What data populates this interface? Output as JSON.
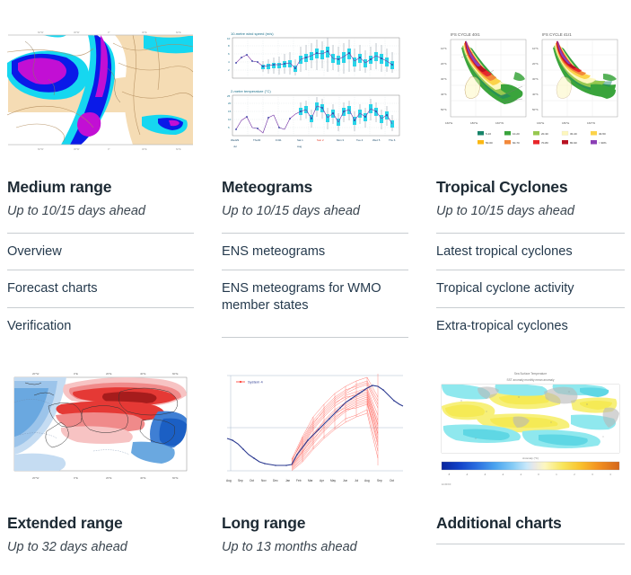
{
  "colors": {
    "heading": "#1d2a34",
    "link": "#253a4d",
    "divider": "#c8cdd1",
    "subtitle": "#3b4650"
  },
  "cards": [
    {
      "id": "medium-range",
      "title": "Medium range",
      "subtitle": "Up to 10/15 days ahead",
      "thumb_name": "medium-range-forecast-map-thumbnail",
      "links": [
        "Overview",
        "Forecast charts",
        "Verification"
      ]
    },
    {
      "id": "meteograms",
      "title": "Meteograms",
      "subtitle": "Up to 10/15 days ahead",
      "thumb_name": "ens-meteogram-thumbnail",
      "links": [
        "ENS meteograms",
        "ENS meteograms for WMO member states"
      ],
      "chart_labels": {
        "panel1": "10-metre wind speed (m/s)",
        "panel2": "2-metre temperature (°C)",
        "x_ticks": [
          "Wed29",
          "Thu30",
          "Fri31",
          "Sat 1",
          "Sun 2",
          "Mon 3",
          "Tue 4",
          "Wed 5",
          "Thu 6",
          "Fri 7",
          "Sat"
        ],
        "x_months": [
          "Jul",
          "Aug"
        ],
        "y1_ticks": [
          "10",
          "8",
          "6",
          "4",
          "2"
        ],
        "y2_ticks": [
          "25",
          "20",
          "15",
          "10",
          "5"
        ]
      }
    },
    {
      "id": "tropical-cyclones",
      "title": "Tropical Cyclones",
      "subtitle": "Up to 10/15 days ahead",
      "thumb_name": "tropical-cyclone-strike-probability-thumbnail",
      "links": [
        "Latest tropical cyclones",
        "Tropical cyclone activity",
        "Extra-tropical cyclones"
      ],
      "chart_labels": {
        "panel1": "IFS CYCLE 40r1",
        "panel2": "IFS CYCLE 41r1",
        "lat_ticks": [
          "10°S",
          "20°S",
          "30°S",
          "40°S",
          "50°S"
        ],
        "lon_ticks": [
          "160°E",
          "180°E",
          "160°W"
        ],
        "legend": [
          {
            "label": "5-10",
            "color": "#17846a"
          },
          {
            "label": "10-20",
            "color": "#3aa43c"
          },
          {
            "label": "20-30",
            "color": "#97c850"
          },
          {
            "label": "30-40",
            "color": "#fdf7bd"
          },
          {
            "label": "40-50",
            "color": "#fcd34a"
          },
          {
            "label": "50-60",
            "color": "#fbb813"
          },
          {
            "label": "60-70",
            "color": "#f2893b"
          },
          {
            "label": "70-80",
            "color": "#e8262a"
          },
          {
            "label": "80-90",
            "color": "#b81222"
          },
          {
            "label": "> 90%",
            "color": "#8b3fb5"
          }
        ]
      }
    },
    {
      "id": "extended-range",
      "title": "Extended range",
      "subtitle": "Up to 32 days ahead",
      "thumb_name": "extended-range-anomaly-map-thumbnail",
      "links": [],
      "chart_labels": {
        "lon_ticks": [
          "20°W",
          "0°E",
          "20°E",
          "40°E",
          "60°E"
        ]
      }
    },
    {
      "id": "long-range",
      "title": "Long range",
      "subtitle": "Up to 13 months ahead",
      "thumb_name": "long-range-ensemble-plume-thumbnail",
      "links": [],
      "chart_labels": {
        "legend": "System 4",
        "x_ticks": [
          "Aug",
          "Sep",
          "Oct",
          "Nov",
          "Dec",
          "Jan",
          "Feb",
          "Mar",
          "Apr",
          "May",
          "Jun",
          "Jul",
          "Aug",
          "Sep",
          "Oct"
        ]
      }
    },
    {
      "id": "additional-charts",
      "title": "Additional charts",
      "subtitle": "",
      "thumb_name": "sea-surface-temperature-anomaly-thumbnail",
      "links": []
    }
  ]
}
